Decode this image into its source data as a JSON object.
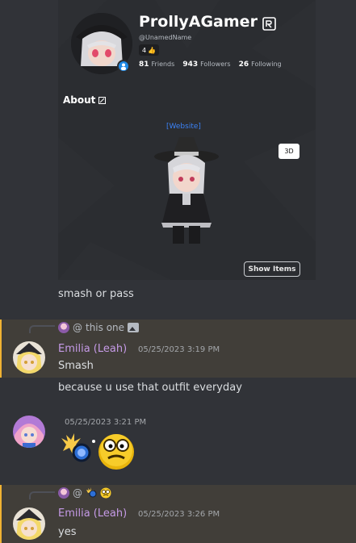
{
  "profile_card": {
    "display_name": "ProllyAGamer",
    "username": "@UnamedName",
    "badge_count": "4",
    "stats": [
      {
        "value": "81",
        "label": "Friends"
      },
      {
        "value": "943",
        "label": "Followers"
      },
      {
        "value": "26",
        "label": "Following"
      }
    ],
    "about_label": "About",
    "website_link": "[Website]",
    "view_3d_label": "3D",
    "show_items_label": "Show Items"
  },
  "messages": [
    {
      "id": "m1",
      "text": "smash or pass"
    },
    {
      "id": "m2",
      "reply_prefix": "@",
      "reply_text": "this one",
      "author": "Emilia (Leah)",
      "timestamp": "05/25/2023 3:19 PM",
      "text": "Smash"
    },
    {
      "id": "m3",
      "text": "because u use that outfit everyday"
    },
    {
      "id": "m4",
      "timestamp": "05/25/2023 3:21 PM"
    },
    {
      "id": "m5",
      "reply_prefix": "@",
      "author": "Emilia (Leah)",
      "timestamp": "05/25/2023 3:26 PM",
      "text": "yes"
    }
  ],
  "colors": {
    "background": "#313338",
    "highlight": "#413e39",
    "author": "#c59ae6",
    "link": "#3b82f6",
    "mention_bar": "#f0b232"
  }
}
